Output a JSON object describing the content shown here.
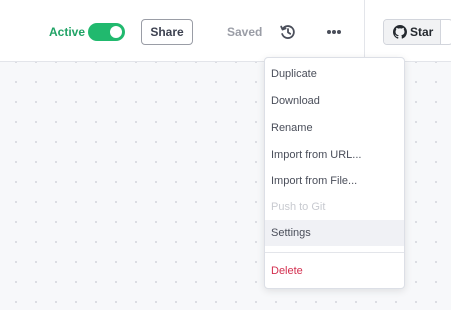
{
  "header": {
    "active_label": "Active",
    "active_toggle": {
      "on": true,
      "color": "#21b96e"
    },
    "share_label": "Share",
    "saved_label": "Saved",
    "history_icon": "history-icon",
    "more_icon": "more-horizontal-icon",
    "github_star": {
      "icon": "github-icon",
      "label": "Star"
    }
  },
  "menu": {
    "items": [
      {
        "label": "Duplicate",
        "disabled": false
      },
      {
        "label": "Download",
        "disabled": false
      },
      {
        "label": "Rename",
        "disabled": false
      },
      {
        "label": "Import from URL...",
        "disabled": false
      },
      {
        "label": "Import from File...",
        "disabled": false
      },
      {
        "label": "Push to Git",
        "disabled": true
      },
      {
        "label": "Settings",
        "disabled": false,
        "highlighted": true
      },
      {
        "label": "Delete",
        "disabled": false,
        "danger": true
      }
    ]
  },
  "colors": {
    "accent_green": "#21a366",
    "danger_red": "#d32f4f",
    "canvas_bg": "#f7f8fa"
  }
}
